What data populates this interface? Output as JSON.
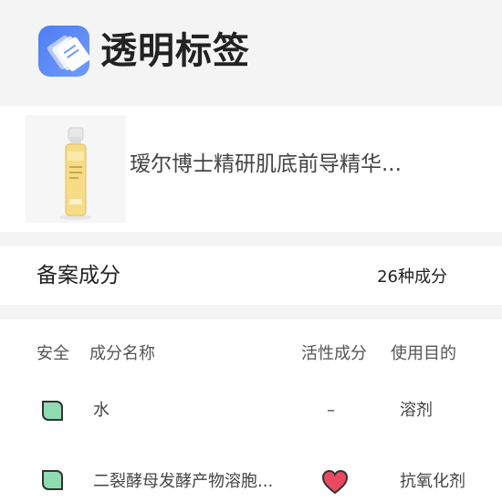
{
  "app": {
    "title": "透明标签",
    "logo_icon": "stacked-tags-logo",
    "accent": "#5b86f5"
  },
  "product": {
    "name": "瑷尔博士精研肌底前导精华...",
    "image_icon": "serum-bottle"
  },
  "section": {
    "title": "备案成分",
    "count": "26种成分"
  },
  "table": {
    "headers": {
      "safety": "安全",
      "name": "成分名称",
      "active": "活性成分",
      "purpose": "使用目的"
    },
    "rows": [
      {
        "safety_icon": "leaf-green-icon",
        "name": "水",
        "active": "–",
        "purpose": "溶剂"
      },
      {
        "safety_icon": "leaf-green-icon",
        "name": "二裂酵母发酵产物溶胞...",
        "active_icon": "heart-icon",
        "purpose": "抗氧化剂"
      }
    ]
  },
  "colors": {
    "safe_green": "#6fcf97",
    "heart_red": "#e84a5f"
  }
}
